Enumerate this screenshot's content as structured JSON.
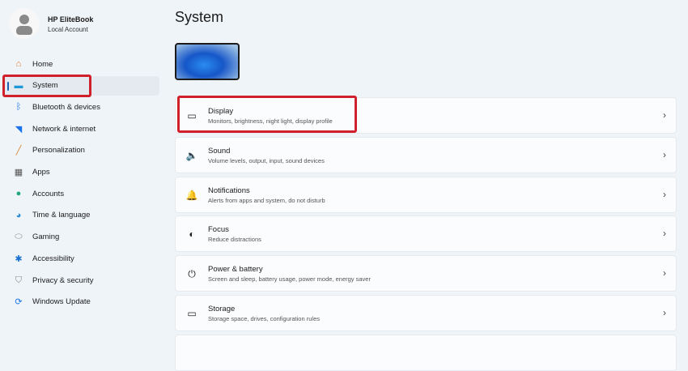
{
  "user": {
    "name": "HP EliteBook",
    "type": "Local Account"
  },
  "nav": [
    {
      "label": "Home",
      "icon": "home-icon",
      "glyph": "⌂",
      "color": "#e07a2e"
    },
    {
      "label": "System",
      "icon": "monitor-icon",
      "glyph": "▬",
      "color": "#1f9ad6"
    },
    {
      "label": "Bluetooth & devices",
      "icon": "bluetooth-icon",
      "glyph": "ᛒ",
      "color": "#1a73e8"
    },
    {
      "label": "Network & internet",
      "icon": "wifi-icon",
      "glyph": "◥",
      "color": "#1a73e8"
    },
    {
      "label": "Personalization",
      "icon": "brush-icon",
      "glyph": "╱",
      "color": "#d4862e"
    },
    {
      "label": "Apps",
      "icon": "apps-icon",
      "glyph": "▦",
      "color": "#555"
    },
    {
      "label": "Accounts",
      "icon": "person-icon",
      "glyph": "●",
      "color": "#1fa67a"
    },
    {
      "label": "Time & language",
      "icon": "globe-clock-icon",
      "glyph": "◕",
      "color": "#2a8ad6"
    },
    {
      "label": "Gaming",
      "icon": "gamepad-icon",
      "glyph": "⬭",
      "color": "#888"
    },
    {
      "label": "Accessibility",
      "icon": "accessibility-icon",
      "glyph": "✱",
      "color": "#1a6fd0"
    },
    {
      "label": "Privacy & security",
      "icon": "shield-icon",
      "glyph": "⛉",
      "color": "#888"
    },
    {
      "label": "Windows Update",
      "icon": "update-icon",
      "glyph": "⟳",
      "color": "#1a73e8"
    }
  ],
  "page_title": "System",
  "cards": [
    {
      "title": "Display",
      "subtitle": "Monitors, brightness, night light, display profile",
      "icon": "laptop-icon",
      "glyph": "▭"
    },
    {
      "title": "Sound",
      "subtitle": "Volume levels, output, input, sound devices",
      "icon": "speaker-icon",
      "glyph": "🔈"
    },
    {
      "title": "Notifications",
      "subtitle": "Alerts from apps and system, do not disturb",
      "icon": "bell-icon",
      "glyph": "🔔"
    },
    {
      "title": "Focus",
      "subtitle": "Reduce distractions",
      "icon": "focus-icon",
      "glyph": "◐"
    },
    {
      "title": "Power & battery",
      "subtitle": "Screen and sleep, battery usage, power mode, energy saver",
      "icon": "power-icon",
      "glyph": "⏻"
    },
    {
      "title": "Storage",
      "subtitle": "Storage space, drives, configuration rules",
      "icon": "storage-icon",
      "glyph": "▭"
    }
  ],
  "chevron": "›",
  "highlight_color": "#d0202c"
}
